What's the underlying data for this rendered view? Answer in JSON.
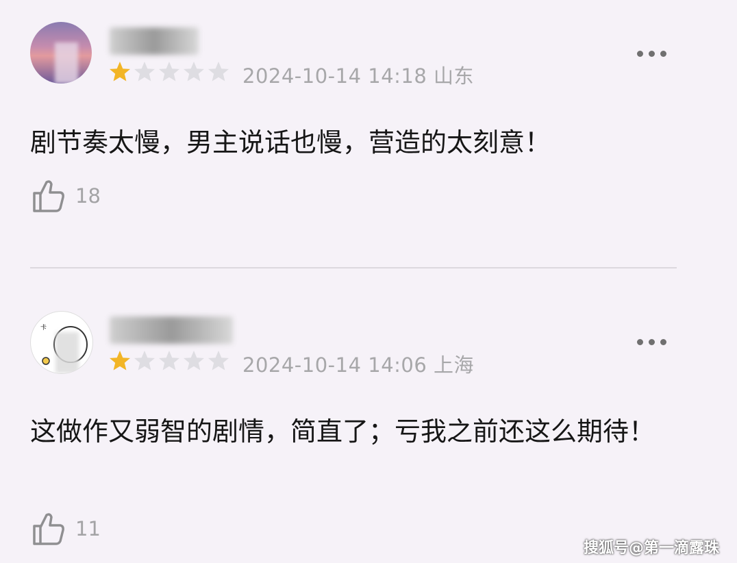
{
  "comments": [
    {
      "rating": 1,
      "rating_max": 5,
      "meta": "2024-10-14 14:18 山东",
      "text": "剧节奏太慢，男主说话也慢，营造的太刻意！",
      "likes": "18"
    },
    {
      "rating": 1,
      "rating_max": 5,
      "meta": "2024-10-14 14:06 上海",
      "text": "这做作又弱智的剧情，简直了；亏我之前还这么期待！",
      "likes": "11"
    }
  ],
  "watermark": "搜狐号@第一滴露珠",
  "colors": {
    "background": "#f6f2f8",
    "star_filled": "#f2b526",
    "star_empty": "#dedde2",
    "meta_text": "#a7a7a9"
  },
  "icons": [
    "star-icon",
    "more-icon",
    "like-icon"
  ]
}
